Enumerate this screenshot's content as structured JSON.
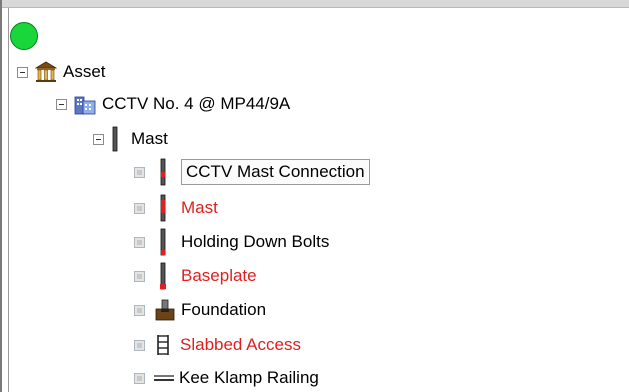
{
  "tree": {
    "root": {
      "label": "Asset"
    },
    "site": {
      "label": "CCTV No. 4 @ MP44/9A"
    },
    "mast": {
      "label": "Mast"
    },
    "children": [
      {
        "label": "CCTV Mast Connection",
        "color": "#000000"
      },
      {
        "label": "Mast",
        "color": "#e02020"
      },
      {
        "label": "Holding Down Bolts",
        "color": "#000000"
      },
      {
        "label": "Baseplate",
        "color": "#e02020"
      },
      {
        "label": "Foundation",
        "color": "#000000"
      },
      {
        "label": "Slabbed Access",
        "color": "#e02020"
      },
      {
        "label": "Kee Klamp Railing",
        "color": "#000000"
      }
    ]
  },
  "status": {
    "color": "#19d63a"
  },
  "icons": {
    "root": "asset-building-icon",
    "site": "cctv-site-icon",
    "mast": "mast-pole-icon",
    "foundation": "foundation-icon",
    "access": "ladder-icon",
    "railing": "railing-icon"
  }
}
